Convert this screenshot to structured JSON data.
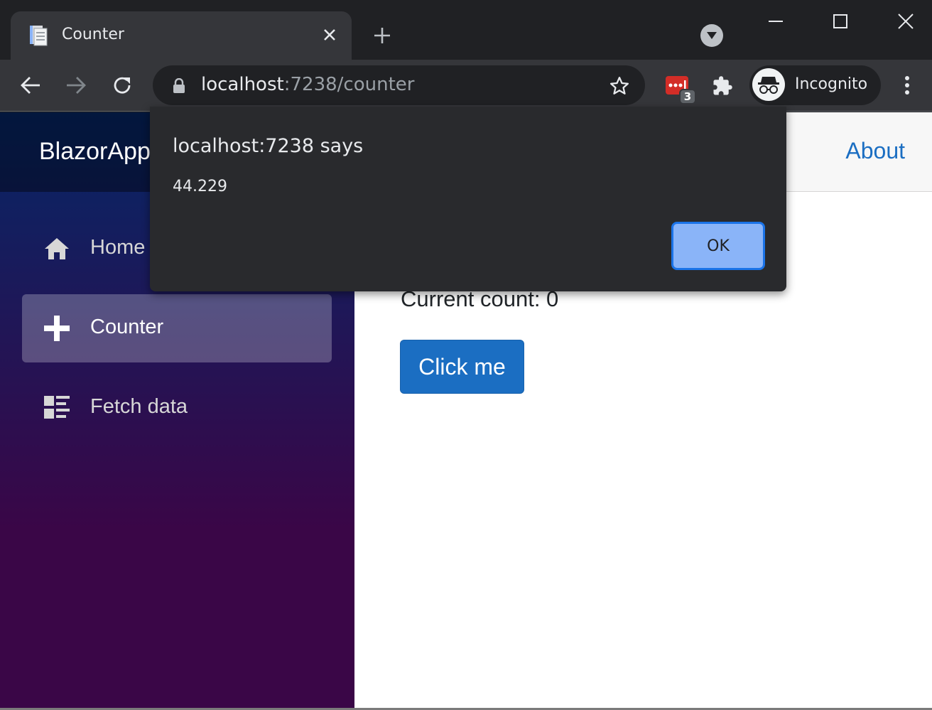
{
  "browser": {
    "tab_title": "Counter",
    "url_host": "localhost",
    "url_path": ":7238/counter",
    "extension_badge": "3",
    "profile_label": "Incognito"
  },
  "app": {
    "brand": "BlazorApp",
    "top_link": "About",
    "nav": [
      {
        "label": "Home",
        "icon": "home-icon"
      },
      {
        "label": "Counter",
        "icon": "plus-icon",
        "active": true
      },
      {
        "label": "Fetch data",
        "icon": "list-icon"
      }
    ],
    "current_count": "Current count: 0",
    "button_label": "Click me"
  },
  "dialog": {
    "title": "localhost:7238 says",
    "message": "44.229",
    "ok_label": "OK"
  },
  "colors": {
    "accent": "#1b6ec2",
    "dialog_button": "#8ab4f8",
    "sidebar_top": "#052767",
    "sidebar_bottom": "#3a0647"
  }
}
